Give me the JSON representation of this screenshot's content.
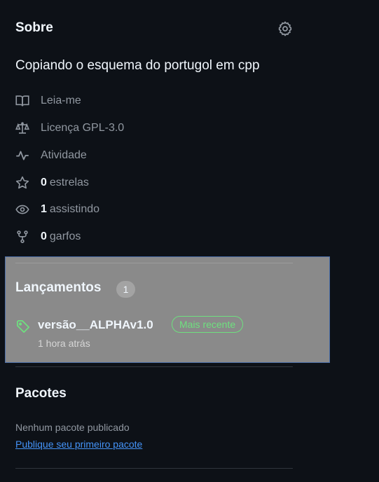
{
  "about": {
    "title": "Sobre",
    "settings_icon": "gear-icon",
    "description": "Copiando o esquema do portugol em cpp",
    "links": [
      {
        "icon": "book-icon",
        "label": "Leia-me"
      },
      {
        "icon": "law-icon",
        "label": "Licença GPL-3.0"
      },
      {
        "icon": "pulse-icon",
        "label": "Atividade"
      },
      {
        "icon": "star-icon",
        "count": "0",
        "label": "estrelas"
      },
      {
        "icon": "eye-icon",
        "count": "1",
        "label": "assistindo"
      },
      {
        "icon": "repo-forked-icon",
        "count": "0",
        "label": "garfos"
      }
    ]
  },
  "releases": {
    "title": "Lançamentos",
    "count": "1",
    "latest": {
      "icon": "tag-icon",
      "name": "versão__ALPHAv1.0",
      "badge": "Mais recente",
      "time": "1 hora atrás"
    }
  },
  "packages": {
    "title": "Pacotes",
    "empty_text": "Nenhum pacote publicado",
    "link_text": "Publique seu primeiro pacote"
  },
  "colors": {
    "background": "#0d1117",
    "text_primary": "#f0f6fc",
    "text_muted": "#9198a1",
    "link": "#4493f8",
    "badge_green": "#6ee07f",
    "highlight_box": "#8a8a8a"
  }
}
